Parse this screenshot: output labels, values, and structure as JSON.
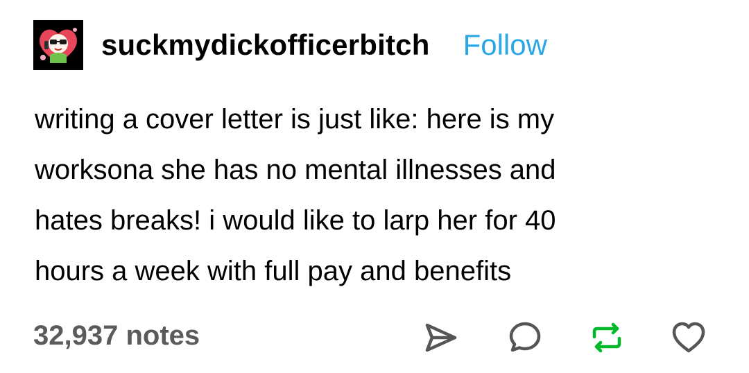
{
  "post": {
    "username": "suckmydickofficerbitch",
    "follow_label": "Follow",
    "body_lines": [
      "writing a cover letter is just like: here is my",
      "worksona she has no mental illnesses and",
      "hates breaks! i would like to larp her for 40",
      "hours a week with full pay and benefits"
    ],
    "notes": "32,937 notes"
  },
  "actions": {
    "share_icon": "share-paper-plane-icon",
    "reply_icon": "reply-speech-bubble-icon",
    "reblog_icon": "reblog-icon",
    "like_icon": "heart-icon"
  },
  "colors": {
    "follow": "#2aa7e6",
    "reblog": "#00b82a",
    "notes": "#5b5b5b",
    "icons": "#555555"
  }
}
